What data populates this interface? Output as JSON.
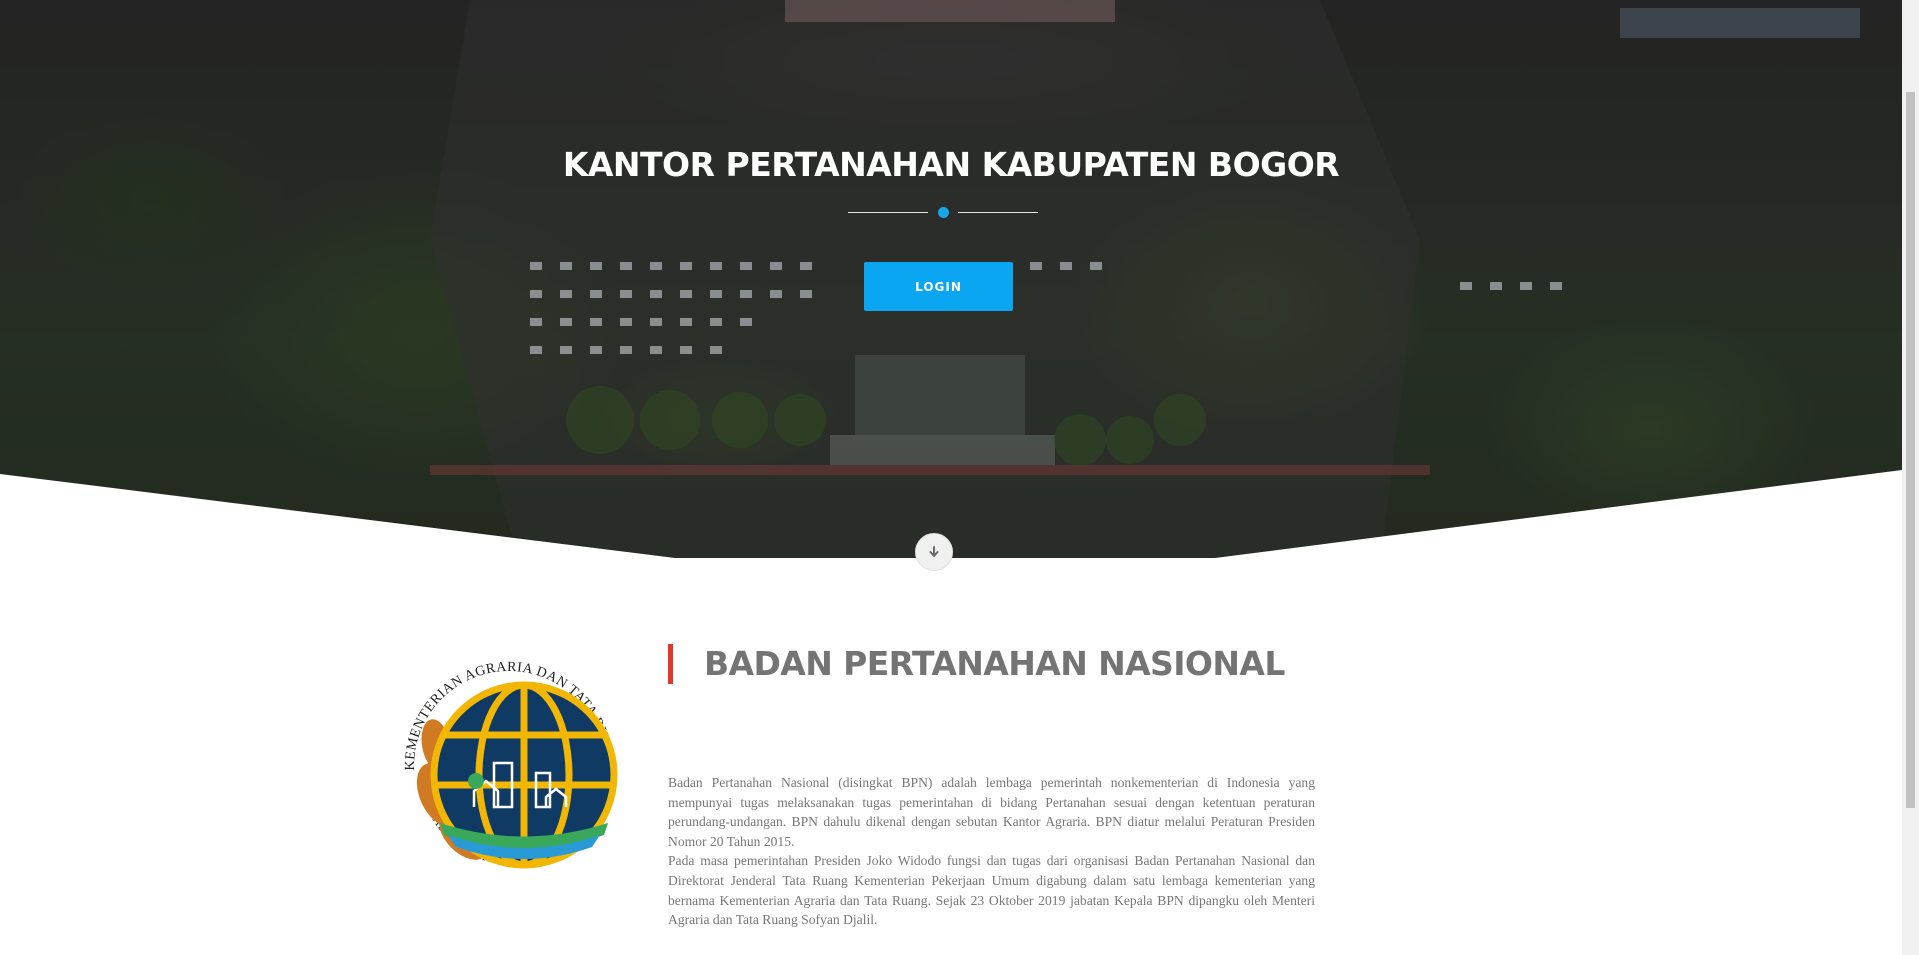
{
  "hero": {
    "title": "KANTOR PERTANAHAN KABUPATEN BOGOR",
    "login_label": "LOGIN",
    "scroll_icon": "arrow-down-icon"
  },
  "about": {
    "title": "BADAN PERTANAHAN NASIONAL",
    "paragraphs": [
      "Badan Pertanahan Nasional (disingkat BPN) adalah lembaga pemerintah nonkementerian di Indonesia yang mempunyai tugas melaksanakan tugas pemerintahan di bidang Pertanahan sesuai dengan ketentuan peraturan perundang-undangan. BPN dahulu dikenal dengan sebutan Kantor Agraria. BPN diatur melalui Peraturan Presiden Nomor 20 Tahun 2015.",
      "Pada masa pemerintahan Presiden Joko Widodo fungsi dan tugas dari organisasi Badan Pertanahan Nasional dan Direktorat Jenderal Tata Ruang Kementerian Pekerjaan Umum digabung dalam satu lembaga kementerian yang bernama Kementerian Agraria dan Tata Ruang. Sejak 23 Oktober 2019 jabatan Kepala BPN dipangku oleh Menteri Agraria dan Tata Ruang Sofyan Djalil."
    ]
  },
  "logo": {
    "top_text": "KEMENTERIAN AGRARIA DAN TATA RUANG",
    "bottom_text": "BADAN PERTANAHAN NASIONAL"
  },
  "colors": {
    "accent_blue": "#0aa6f2",
    "accent_red": "#e2372e",
    "logo_navy": "#0f3a63",
    "logo_gold": "#f2b705"
  }
}
